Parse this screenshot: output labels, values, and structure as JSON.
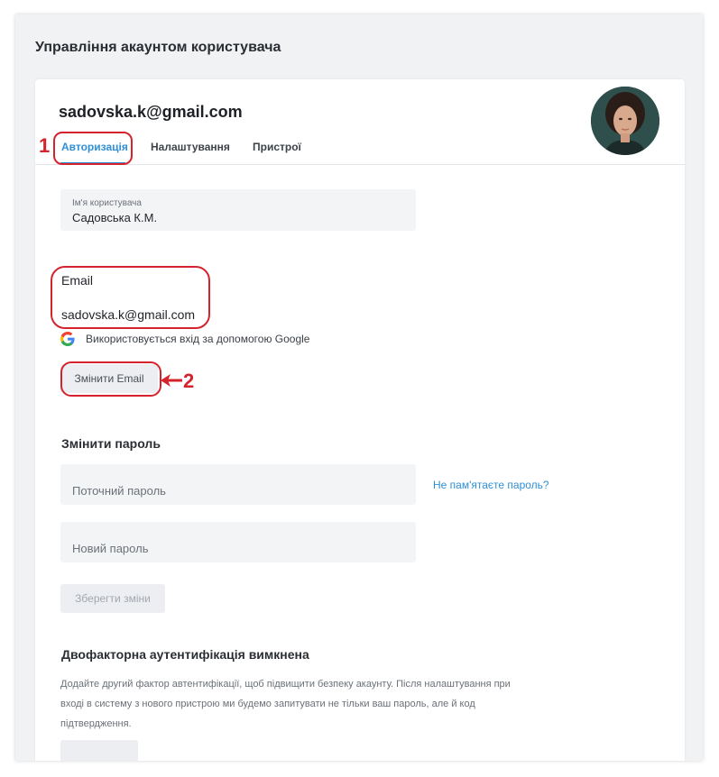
{
  "page": {
    "title": "Управління акаунтом користувача"
  },
  "card": {
    "email": "sadovska.k@gmail.com",
    "tabs": [
      {
        "label": "Авторизація",
        "active": true
      },
      {
        "label": "Налаштування",
        "active": false
      },
      {
        "label": "Пристрої",
        "active": false
      }
    ]
  },
  "username_field": {
    "label": "Ім'я користувача",
    "value": "Садовська К.М."
  },
  "email_section": {
    "label": "Email",
    "value": "sadovska.k@gmail.com",
    "google_note": "Використовується вхід за допомогою Google",
    "change_button": "Змінити Email"
  },
  "password_section": {
    "title": "Змінити пароль",
    "current_placeholder": "Поточний пароль",
    "new_placeholder": "Новий пароль",
    "forgot_link": "Не пам'ятаєте пароль?",
    "save_button": "Зберегти зміни"
  },
  "twofa_section": {
    "title": "Двофакторна аутентифікація вимкнена",
    "description_lines": [
      "Додайте другий фактор автентифікації, щоб підвищити безпеку акаунту. Після налаштування при",
      "вході в систему з нового пристрою ми будемо запитувати не тільки ваш пароль, але й код",
      "підтвердження."
    ]
  },
  "annotations": {
    "marker_1": "1",
    "marker_2": "2",
    "color": "#d5232d"
  },
  "colors": {
    "accent": "#2f8fd6",
    "background": "#f1f2f4"
  }
}
